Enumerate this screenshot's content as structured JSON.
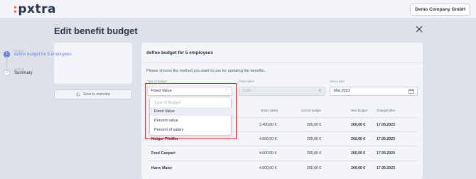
{
  "app": {
    "logo": ":pxtra",
    "company_button": "Demo Company GmbH"
  },
  "dialog": {
    "title": "Edit benefit budget"
  },
  "stepper": {
    "steps": [
      {
        "small": "STEP 01",
        "label": "define budget for 5 employees",
        "number": "1"
      },
      {
        "small": "STEP 02",
        "label": "Summary",
        "number": "2"
      }
    ],
    "save_label": "Save to overview"
  },
  "card": {
    "title": "define budget for 5 employees",
    "instruction": "Please choose the method you want to use for updating the benefits.",
    "type_label": "Type of Budget",
    "type_value": "Fixed Value",
    "fixed_label": "Fixed Value",
    "fixed_placeholder": "0,00",
    "fixed_currency": "€",
    "date_label": "Select date",
    "date_value": "Mai 2023"
  },
  "dropdown": {
    "options": [
      {
        "label": "Type of Budget",
        "placeholder": true
      },
      {
        "label": "Fixed Value",
        "selected": true
      },
      {
        "label": "Percent value"
      },
      {
        "label": "Percent of salary"
      }
    ]
  },
  "table": {
    "headers": [
      "Gross salary",
      "current budget",
      "New budget",
      "changed after"
    ],
    "rows": [
      {
        "name": "",
        "gross": "2.400,00 €",
        "current": "200,00 €",
        "new": "200,00 €",
        "date": "17.05.2023"
      },
      {
        "name": "Holger Pfeiffer",
        "gross": "4.600,00 €",
        "current": "200,00 €",
        "new": "200,00 €",
        "date": "17.05.2023"
      },
      {
        "name": "Fred Caspari",
        "gross": "4.000,00 €",
        "current": "200,00 €",
        "new": "200,00 €",
        "date": "17.05.2023"
      },
      {
        "name": "Hans Maier",
        "gross": "4.000,00 €",
        "current": "200,00 €",
        "new": "200,00 €",
        "date": "17.05.2023"
      }
    ]
  },
  "colors": {
    "accent": "#6c7ee0",
    "logo_dot": "#e07a55",
    "highlight": "#e02020"
  }
}
